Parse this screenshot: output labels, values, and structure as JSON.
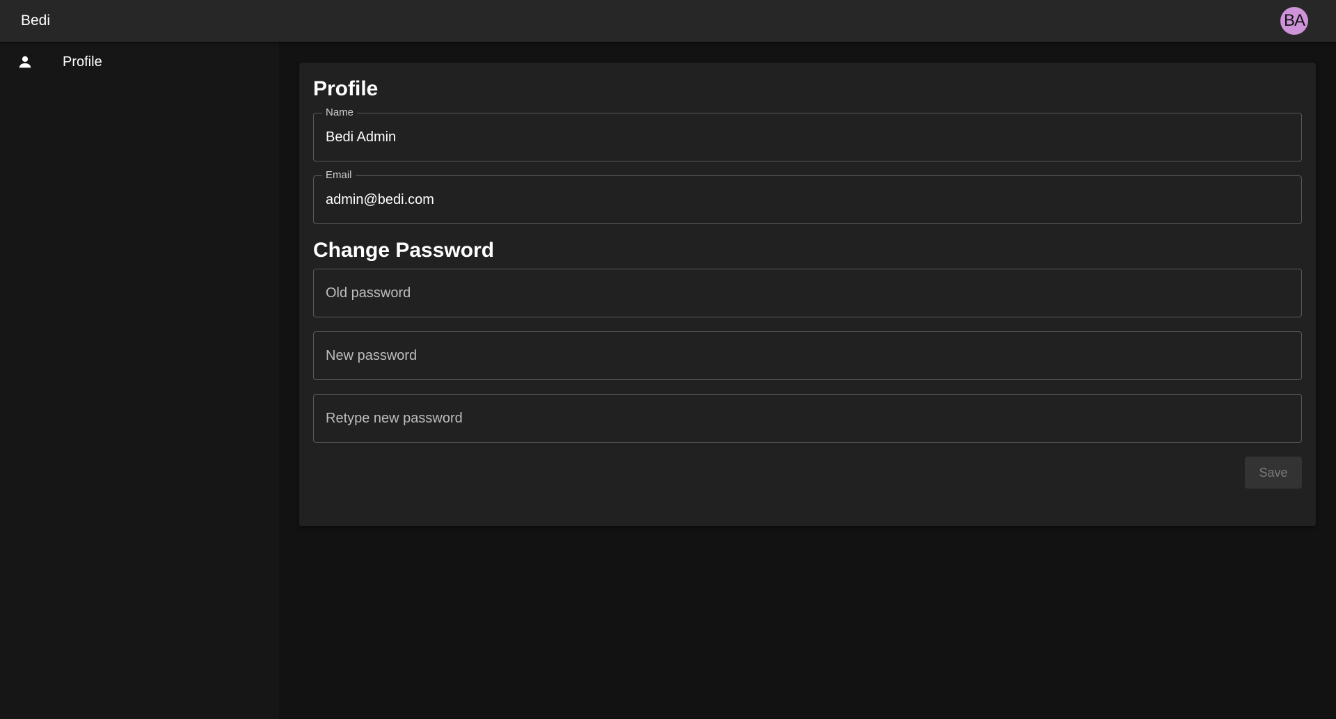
{
  "appbar": {
    "brand": "Bedi",
    "avatar_initials": "BA",
    "avatar_color": "#ce93d8"
  },
  "sidebar": {
    "items": [
      {
        "label": "Profile",
        "icon": "person-icon"
      }
    ]
  },
  "profile": {
    "title": "Profile",
    "name": {
      "label": "Name",
      "value": "Bedi Admin"
    },
    "email": {
      "label": "Email",
      "value": "admin@bedi.com"
    }
  },
  "password": {
    "title": "Change Password",
    "old_placeholder": "Old password",
    "new_placeholder": "New password",
    "retype_placeholder": "Retype new password"
  },
  "actions": {
    "save_label": "Save",
    "save_disabled": true
  },
  "colors": {
    "background": "#121212",
    "appbar": "#272727",
    "card": "#212121"
  }
}
